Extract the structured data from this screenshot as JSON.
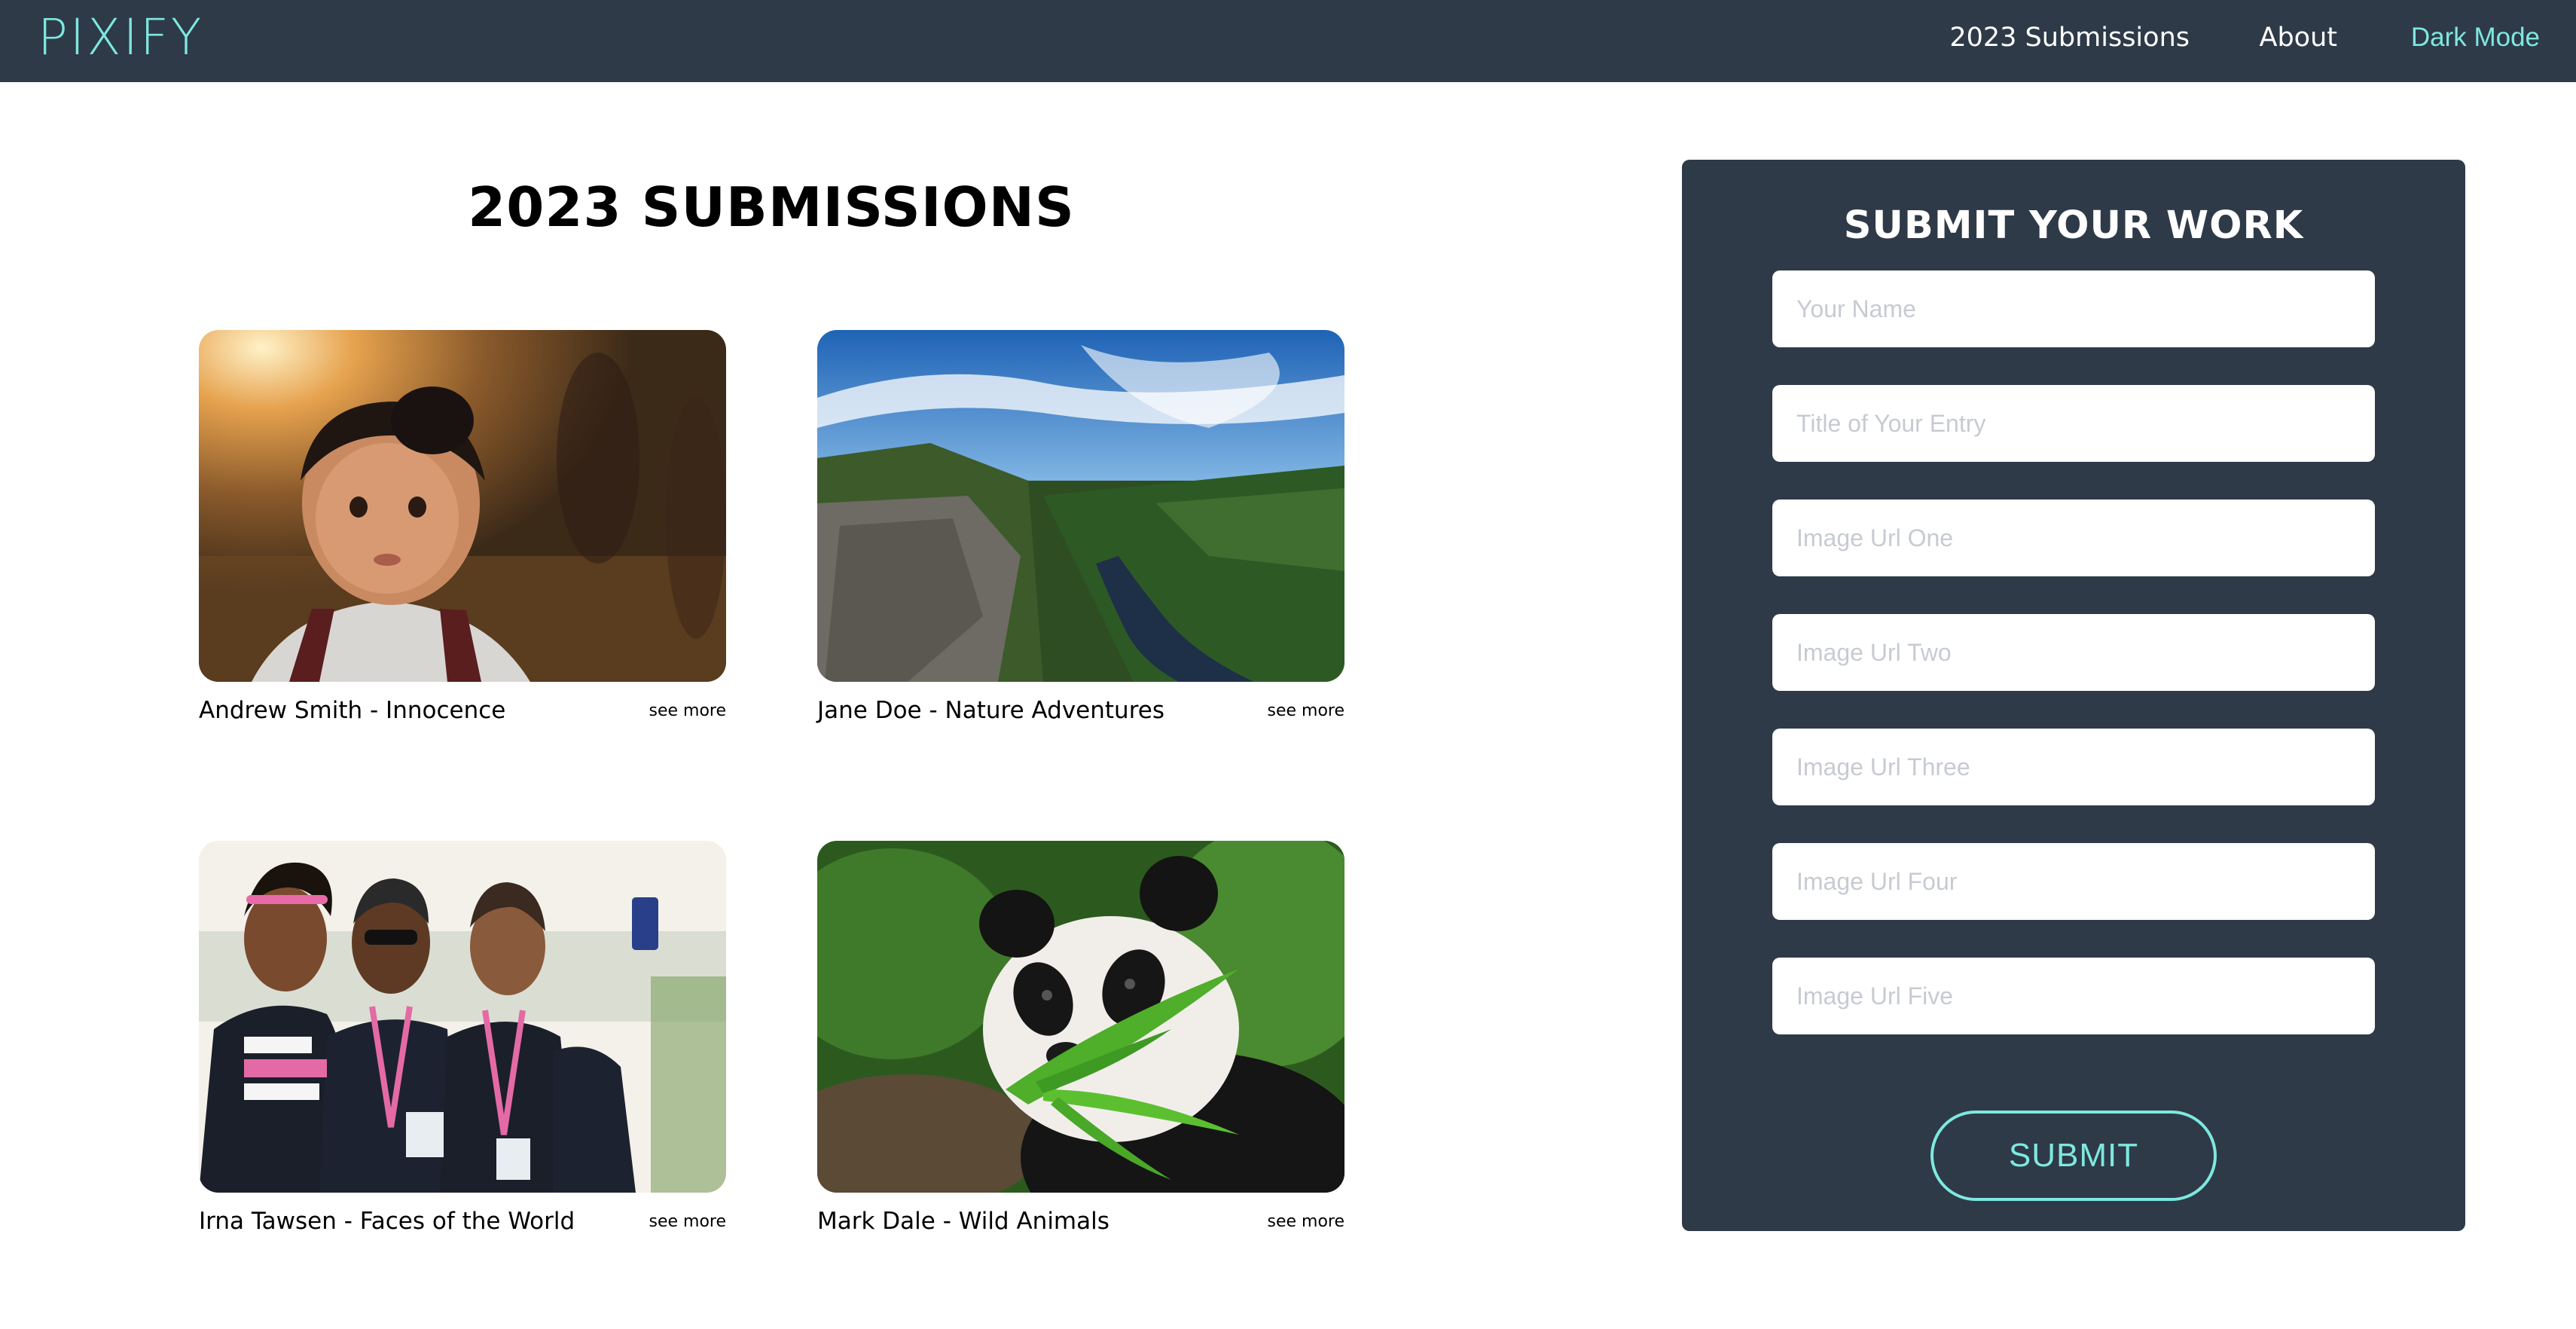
{
  "nav": {
    "logo": "PIXIFY",
    "links": {
      "submissions": "2023 Submissions",
      "about": "About",
      "dark_mode": "Dark Mode"
    }
  },
  "main": {
    "title": "2023 SUBMISSIONS",
    "cards": [
      {
        "caption": "Andrew Smith - Innocence",
        "see_more": "see more",
        "image": "child-portrait-photo"
      },
      {
        "caption": "Jane Doe - Nature Adventures",
        "see_more": "see more",
        "image": "canyon-river-landscape-photo"
      },
      {
        "caption": "Irna Tawsen - Faces of the World",
        "see_more": "see more",
        "image": "three-women-event-photo"
      },
      {
        "caption": "Mark Dale - Wild Animals",
        "see_more": "see more",
        "image": "panda-eating-bamboo-photo"
      }
    ]
  },
  "form": {
    "title": "SUBMIT YOUR WORK",
    "fields": [
      {
        "placeholder": "Your Name",
        "value": ""
      },
      {
        "placeholder": "Title of Your Entry",
        "value": ""
      },
      {
        "placeholder": "Image Url One",
        "value": ""
      },
      {
        "placeholder": "Image Url Two",
        "value": ""
      },
      {
        "placeholder": "Image Url Three",
        "value": ""
      },
      {
        "placeholder": "Image Url Four",
        "value": ""
      },
      {
        "placeholder": "Image Url Five",
        "value": ""
      }
    ],
    "submit_label": "SUBMIT"
  },
  "colors": {
    "navbar_bg": "#2e3a48",
    "accent": "#7ee8e0",
    "panel_bg": "#2e3a48",
    "page_bg": "#ffffff"
  }
}
